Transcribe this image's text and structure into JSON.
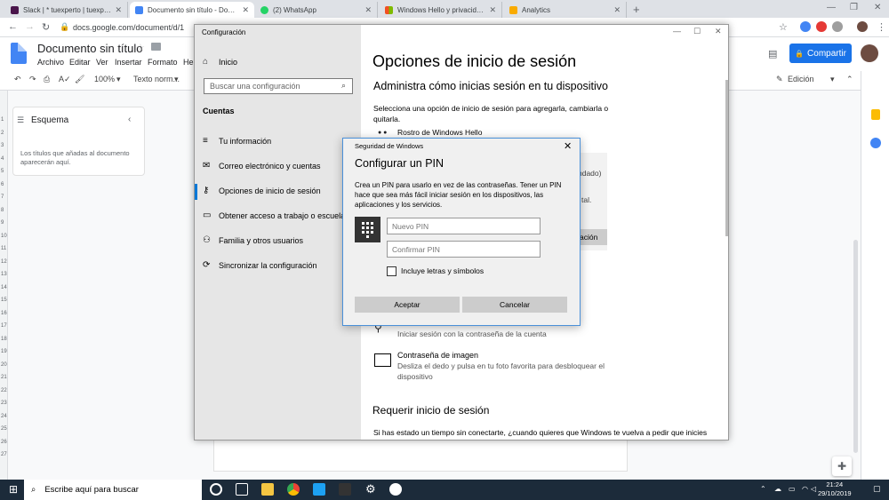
{
  "browser": {
    "tabs": [
      {
        "title": "Slack | * tuexperto | tuexperto | W",
        "color": "#4a154b"
      },
      {
        "title": "Documento sin título - Documen",
        "color": "#4285f4"
      },
      {
        "title": "(2) WhatsApp",
        "color": "#25d366"
      },
      {
        "title": "Windows Hello y privacidad: priv",
        "color": "#f25022"
      },
      {
        "title": "Analytics",
        "color": "#f9ab00"
      }
    ],
    "new_tab": "+",
    "url": "docs.google.com/document/d/1"
  },
  "docs": {
    "title": "Documento sin título",
    "menu": [
      "Archivo",
      "Editar",
      "Ver",
      "Insertar",
      "Formato",
      "Her"
    ],
    "share": "Compartir",
    "zoom": "100%",
    "style": "Texto norm...",
    "mode": "Edición",
    "outline_title": "Esquema",
    "outline_text": "Los títulos que añadas al documento aparecerán aquí.",
    "ruler": [
      "1",
      "2",
      "3",
      "4",
      "5",
      "6",
      "7",
      "8",
      "9",
      "10",
      "11",
      "12",
      "13",
      "14",
      "15",
      "16",
      "17",
      "18",
      "19",
      "20",
      "21",
      "22",
      "23",
      "24",
      "25",
      "26",
      "27"
    ]
  },
  "settings": {
    "window_title": "Configuración",
    "home": "Inicio",
    "search_placeholder": "Buscar una configuración",
    "section": "Cuentas",
    "nav": [
      "Tu información",
      "Correo electrónico y cuentas",
      "Opciones de inicio de sesión",
      "Obtener acceso a trabajo o escuela",
      "Familia y otros usuarios",
      "Sincronizar la configuración"
    ],
    "heading": "Opciones de inicio de sesión",
    "subheading": "Administra cómo inicias sesión en tu dispositivo",
    "intro": "Selecciona una opción de inicio de sesión para agregarla, cambiarla o quitarla.",
    "face_option": "Rostro de Windows Hello",
    "bg_frag1": "ndado)",
    "bg_frag2": "tal.",
    "bg_button": "ación",
    "pwd_desc": "Iniciar sesión con la contraseña de la cuenta",
    "pic_title": "Contraseña de imagen",
    "pic_desc": "Desliza el dedo y pulsa en tu foto favorita para desbloquear el dispositivo",
    "require_heading": "Requerir inicio de sesión",
    "require_text": "Si has estado un tiempo sin conectarte, ¿cuando quieres que Windows te vuelva a pedir que inicies"
  },
  "pin_dialog": {
    "header": "Seguridad de Windows",
    "title": "Configurar un PIN",
    "description": "Crea un PIN para usarlo en vez de las contraseñas. Tener un PIN hace que sea más fácil iniciar sesión en los dispositivos, las aplicaciones y los servicios.",
    "new_pin_placeholder": "Nuevo PIN",
    "confirm_pin_placeholder": "Confirmar PIN",
    "checkbox_label": "Incluye letras y símbolos",
    "checkbox_checked": false,
    "accept": "Aceptar",
    "cancel": "Cancelar"
  },
  "taskbar": {
    "search_placeholder": "Escribe aquí para buscar",
    "time": "21:24",
    "date": "29/10/2019"
  }
}
